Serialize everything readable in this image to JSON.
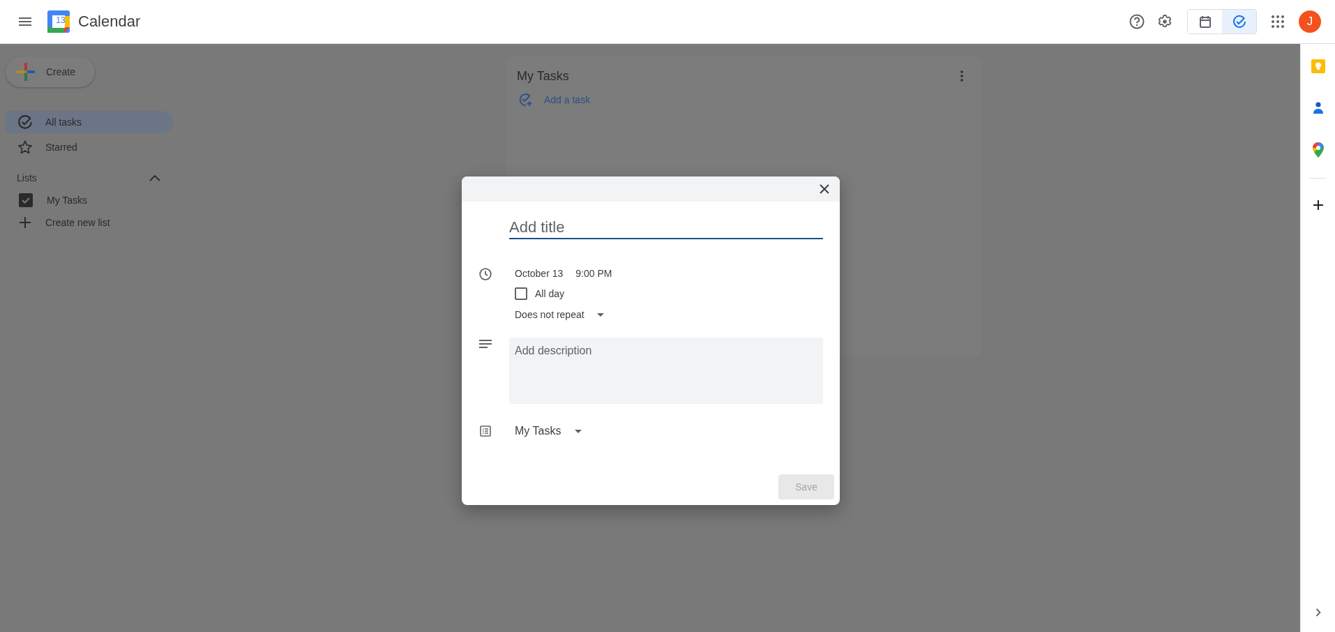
{
  "header": {
    "app_name": "Calendar",
    "logo_day": "13",
    "avatar_initial": "J",
    "view_toggle": [
      {
        "kind": "calendar",
        "selected": false
      },
      {
        "kind": "tasks",
        "selected": true
      }
    ]
  },
  "sidebar": {
    "create_label": "Create",
    "nav": [
      {
        "label": "All tasks",
        "kind": "check",
        "selected": true
      },
      {
        "label": "Starred",
        "kind": "star",
        "selected": false
      }
    ],
    "lists_heading": "Lists",
    "lists_expanded": true,
    "lists": [
      {
        "label": "My Tasks",
        "checked": true
      }
    ],
    "create_list_label": "Create new list"
  },
  "task_panel": {
    "title": "My Tasks",
    "add_task_label": "Add a task"
  },
  "side_panel": {
    "apps": [
      {
        "kind": "keep"
      },
      {
        "kind": "contacts"
      },
      {
        "kind": "maps"
      }
    ]
  },
  "dialog": {
    "title_placeholder": "Add title",
    "date": "October 13",
    "time": "9:00 PM",
    "all_day": false,
    "all_day_label": "All day",
    "repeat": "Does not repeat",
    "description_placeholder": "Add description",
    "list": "My Tasks",
    "save_label": "Save",
    "save_disabled": true
  }
}
